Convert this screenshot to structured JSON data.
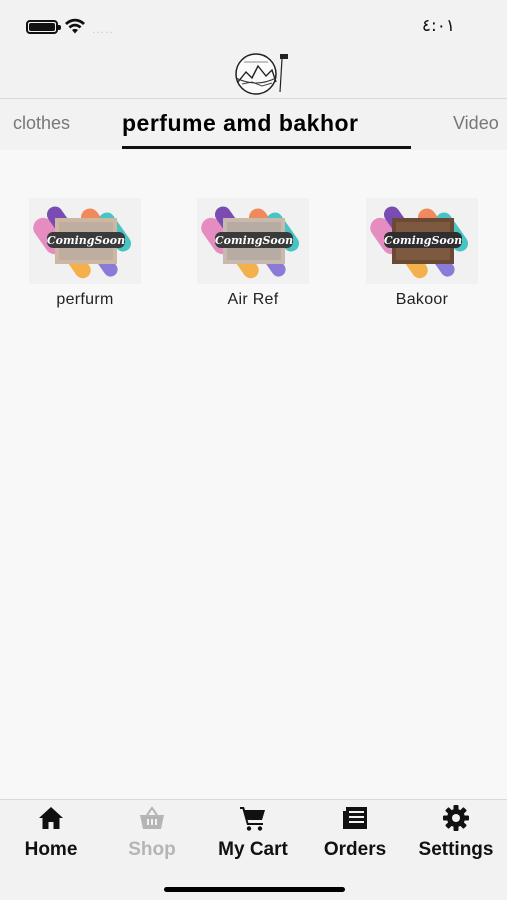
{
  "status_bar": {
    "time": "٤:٠١",
    "carrier": "....."
  },
  "tabs": [
    {
      "label": "clothes",
      "selected": false
    },
    {
      "label": "perfume amd bakhor",
      "selected": true
    },
    {
      "label": "Video",
      "selected": false
    }
  ],
  "products": [
    {
      "label": "perfurm",
      "image": "coming-soon-banner"
    },
    {
      "label": "Air Ref",
      "image": "coming-soon-banner"
    },
    {
      "label": "Bakoor",
      "image": "coming-soon-banner"
    }
  ],
  "bottom_nav": [
    {
      "label": "Home",
      "icon": "home-icon",
      "active": true
    },
    {
      "label": "Shop",
      "icon": "basket-icon",
      "active": false
    },
    {
      "label": "My Cart",
      "icon": "cart-icon",
      "active": true
    },
    {
      "label": "Orders",
      "icon": "orders-icon",
      "active": true
    },
    {
      "label": "Settings",
      "icon": "gear-icon",
      "active": true
    }
  ],
  "colors": {
    "background": "#f8f8f8",
    "bar": "#f2f2f2",
    "text": "#111111",
    "muted": "#b5b5b5"
  }
}
